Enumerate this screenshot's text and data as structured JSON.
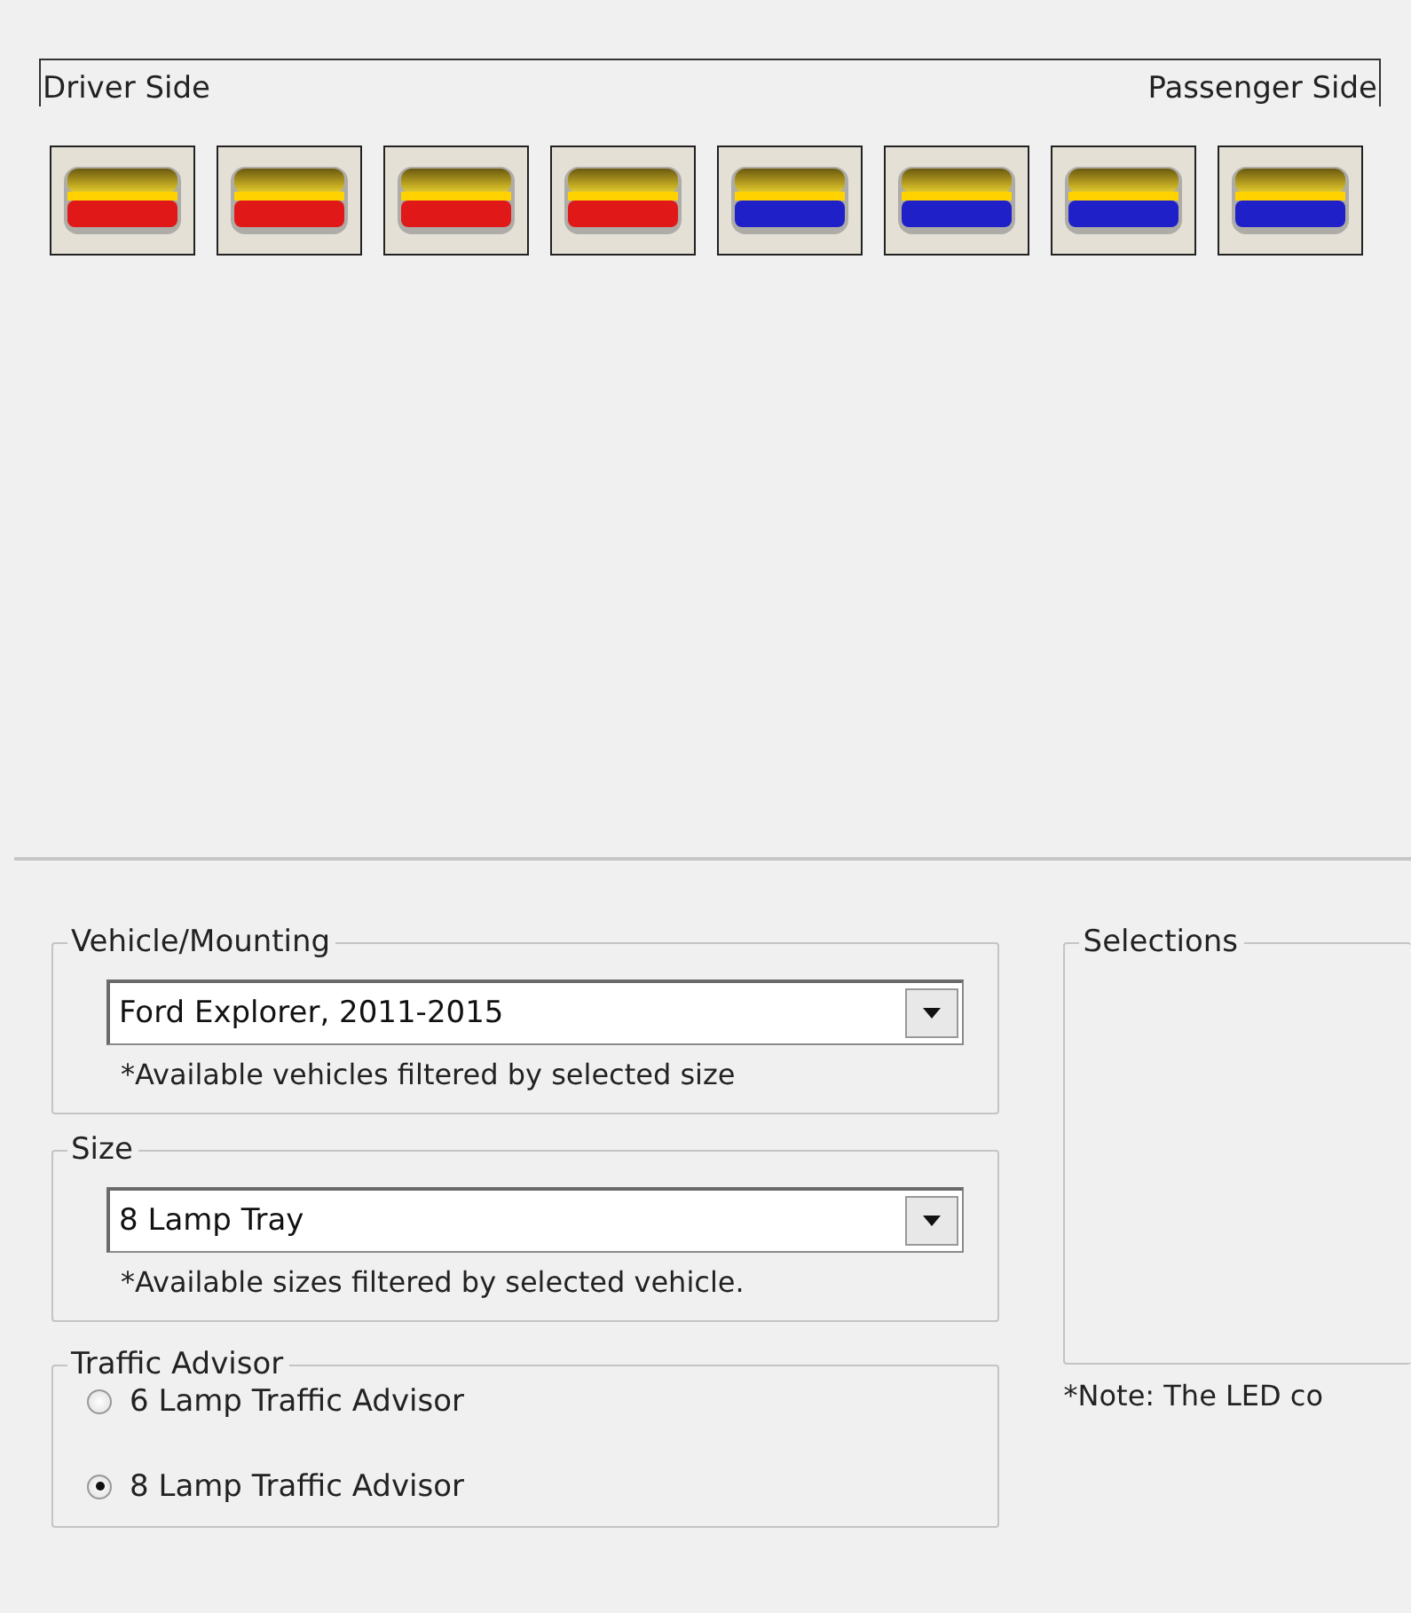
{
  "lightbar": {
    "left_label": "Driver Side",
    "right_label": "Passenger Side",
    "lamps": [
      {
        "color": "#e01818"
      },
      {
        "color": "#e01818"
      },
      {
        "color": "#e01818"
      },
      {
        "color": "#e01818"
      },
      {
        "color": "#2020c8"
      },
      {
        "color": "#2020c8"
      },
      {
        "color": "#2020c8"
      },
      {
        "color": "#2020c8"
      }
    ]
  },
  "vehicle_mounting": {
    "title": "Vehicle/Mounting",
    "value": "Ford Explorer, 2011-2015",
    "note": "*Available vehicles filtered by selected size"
  },
  "size": {
    "title": "Size",
    "value": "8 Lamp Tray",
    "note": "*Available sizes filtered by selected vehicle."
  },
  "traffic_advisor": {
    "title": "Traffic Advisor",
    "options": [
      {
        "label": "6 Lamp Traffic Advisor",
        "selected": false
      },
      {
        "label": "8 Lamp Traffic Advisor",
        "selected": true
      }
    ]
  },
  "selections": {
    "title": "Selections",
    "note": "*Note: The LED co"
  }
}
